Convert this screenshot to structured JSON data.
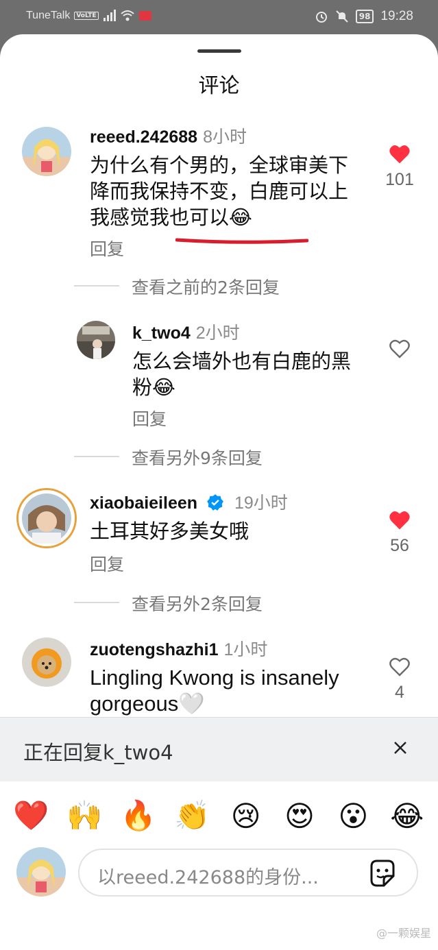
{
  "status_bar": {
    "carrier": "TuneTalk",
    "volte": "VoLTE",
    "battery": "98",
    "time": "19:28"
  },
  "sheet": {
    "title": "评论"
  },
  "comments": [
    {
      "username": "reeed.242688",
      "time": "8小时",
      "text": "为什么有个男的，全球审美下降而我保持不变，白鹿可以上我感觉我也可以😂",
      "reply_label": "回复",
      "liked": true,
      "likes": "101"
    },
    {
      "username": "k_two4",
      "time": "2小时",
      "text": "怎么会墙外也有白鹿的黑粉😂",
      "reply_label": "回复",
      "liked": false,
      "likes": ""
    },
    {
      "username": "xiaobaieileen",
      "time": "19小时",
      "text": "土耳其好多美女哦",
      "reply_label": "回复",
      "liked": true,
      "likes": "56"
    },
    {
      "username": "zuotengshazhi1",
      "time": "1小时",
      "text": "Lingling Kwong is insanely gorgeous🤍",
      "reply_label": "",
      "liked": false,
      "likes": "4"
    }
  ],
  "view_replies": [
    "查看之前的2条回复",
    "查看另外9条回复",
    "查看另外2条回复"
  ],
  "replying": {
    "text": "正在回复k_two4"
  },
  "emoji_bar": [
    "❤️",
    "🙌",
    "🔥",
    "👏",
    "😢",
    "😍",
    "😮",
    "😂"
  ],
  "composer": {
    "placeholder": "以reeed.242688的身份..."
  },
  "watermark": "@一颗娱星",
  "colors": {
    "like_red": "#ff3040",
    "verified_blue": "#0095f6",
    "underline_red": "#d81e2c"
  }
}
